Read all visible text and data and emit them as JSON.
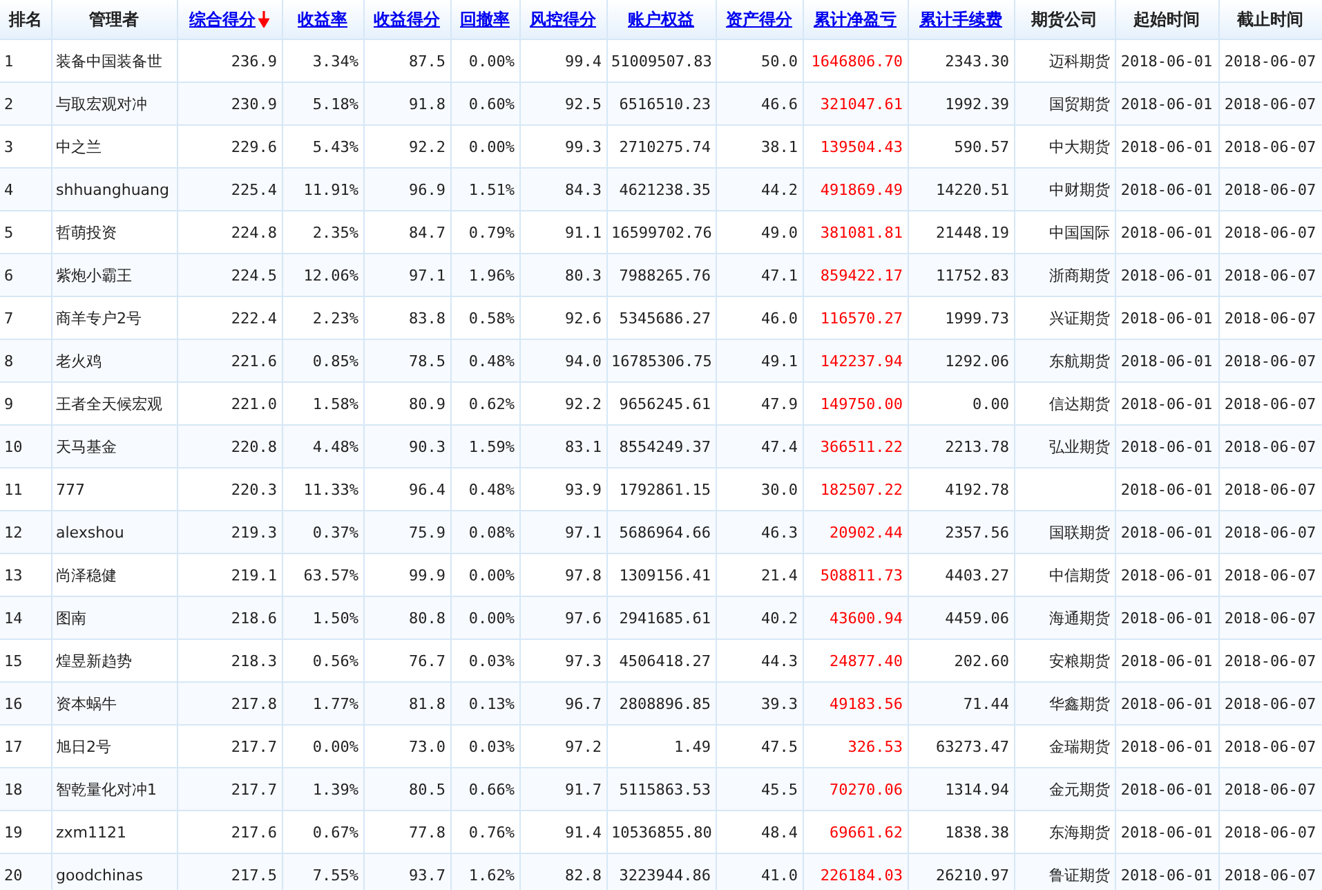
{
  "table": {
    "columns": [
      {
        "label": "排名",
        "kind": "plain",
        "sorted": false,
        "accent": false
      },
      {
        "label": "管理者",
        "kind": "plain",
        "sorted": false,
        "accent": false
      },
      {
        "label": "综合得分",
        "kind": "link",
        "sorted": true,
        "accent": false
      },
      {
        "label": "收益率",
        "kind": "link",
        "sorted": false,
        "accent": false
      },
      {
        "label": "收益得分",
        "kind": "link",
        "sorted": false,
        "accent": false
      },
      {
        "label": "回撤率",
        "kind": "link",
        "sorted": false,
        "accent": false
      },
      {
        "label": "风控得分",
        "kind": "link",
        "sorted": false,
        "accent": false
      },
      {
        "label": "账户权益",
        "kind": "link",
        "sorted": false,
        "accent": false
      },
      {
        "label": "资产得分",
        "kind": "link",
        "sorted": false,
        "accent": false
      },
      {
        "label": "累计净盈亏",
        "kind": "link",
        "sorted": false,
        "accent": true
      },
      {
        "label": "累计手续费",
        "kind": "link",
        "sorted": false,
        "accent": false
      },
      {
        "label": "期货公司",
        "kind": "plain",
        "sorted": false,
        "accent": false
      },
      {
        "label": "起始时间",
        "kind": "plain",
        "sorted": false,
        "accent": false
      },
      {
        "label": "截止时间",
        "kind": "plain",
        "sorted": false,
        "accent": false
      }
    ],
    "rows": [
      {
        "cells": [
          "1",
          "装备中国装备世",
          "236.9",
          "3.34%",
          "87.5",
          "0.00%",
          "99.4",
          "51009507.83",
          "50.0",
          "1646806.70",
          "2343.30",
          "迈科期货",
          "2018-06-01",
          "2018-06-07"
        ]
      },
      {
        "cells": [
          "2",
          "与取宏观对冲",
          "230.9",
          "5.18%",
          "91.8",
          "0.60%",
          "92.5",
          "6516510.23",
          "46.6",
          "321047.61",
          "1992.39",
          "国贸期货",
          "2018-06-01",
          "2018-06-07"
        ]
      },
      {
        "cells": [
          "3",
          "中之兰",
          "229.6",
          "5.43%",
          "92.2",
          "0.00%",
          "99.3",
          "2710275.74",
          "38.1",
          "139504.43",
          "590.57",
          "中大期货",
          "2018-06-01",
          "2018-06-07"
        ]
      },
      {
        "cells": [
          "4",
          "shhuanghuang",
          "225.4",
          "11.91%",
          "96.9",
          "1.51%",
          "84.3",
          "4621238.35",
          "44.2",
          "491869.49",
          "14220.51",
          "中财期货",
          "2018-06-01",
          "2018-06-07"
        ]
      },
      {
        "cells": [
          "5",
          "哲萌投资",
          "224.8",
          "2.35%",
          "84.7",
          "0.79%",
          "91.1",
          "16599702.76",
          "49.0",
          "381081.81",
          "21448.19",
          "中国国际",
          "2018-06-01",
          "2018-06-07"
        ]
      },
      {
        "cells": [
          "6",
          "紫炮小霸王",
          "224.5",
          "12.06%",
          "97.1",
          "1.96%",
          "80.3",
          "7988265.76",
          "47.1",
          "859422.17",
          "11752.83",
          "浙商期货",
          "2018-06-01",
          "2018-06-07"
        ]
      },
      {
        "cells": [
          "7",
          "商羊专户2号",
          "222.4",
          "2.23%",
          "83.8",
          "0.58%",
          "92.6",
          "5345686.27",
          "46.0",
          "116570.27",
          "1999.73",
          "兴证期货",
          "2018-06-01",
          "2018-06-07"
        ]
      },
      {
        "cells": [
          "8",
          "老火鸡",
          "221.6",
          "0.85%",
          "78.5",
          "0.48%",
          "94.0",
          "16785306.75",
          "49.1",
          "142237.94",
          "1292.06",
          "东航期货",
          "2018-06-01",
          "2018-06-07"
        ]
      },
      {
        "cells": [
          "9",
          "王者全天候宏观",
          "221.0",
          "1.58%",
          "80.9",
          "0.62%",
          "92.2",
          "9656245.61",
          "47.9",
          "149750.00",
          "0.00",
          "信达期货",
          "2018-06-01",
          "2018-06-07"
        ]
      },
      {
        "cells": [
          "10",
          "天马基金",
          "220.8",
          "4.48%",
          "90.3",
          "1.59%",
          "83.1",
          "8554249.37",
          "47.4",
          "366511.22",
          "2213.78",
          "弘业期货",
          "2018-06-01",
          "2018-06-07"
        ]
      },
      {
        "cells": [
          "11",
          "777",
          "220.3",
          "11.33%",
          "96.4",
          "0.48%",
          "93.9",
          "1792861.15",
          "30.0",
          "182507.22",
          "4192.78",
          null,
          "2018-06-01",
          "2018-06-07"
        ]
      },
      {
        "cells": [
          "12",
          "alexshou",
          "219.3",
          "0.37%",
          "75.9",
          "0.08%",
          "97.1",
          "5686964.66",
          "46.3",
          "20902.44",
          "2357.56",
          "国联期货",
          "2018-06-01",
          "2018-06-07"
        ]
      },
      {
        "cells": [
          "13",
          "尚泽稳健",
          "219.1",
          "63.57%",
          "99.9",
          "0.00%",
          "97.8",
          "1309156.41",
          "21.4",
          "508811.73",
          "4403.27",
          "中信期货",
          "2018-06-01",
          "2018-06-07"
        ]
      },
      {
        "cells": [
          "14",
          "图南",
          "218.6",
          "1.50%",
          "80.8",
          "0.00%",
          "97.6",
          "2941685.61",
          "40.2",
          "43600.94",
          "4459.06",
          "海通期货",
          "2018-06-01",
          "2018-06-07"
        ]
      },
      {
        "cells": [
          "15",
          "煌昱新趋势",
          "218.3",
          "0.56%",
          "76.7",
          "0.03%",
          "97.3",
          "4506418.27",
          "44.3",
          "24877.40",
          "202.60",
          "安粮期货",
          "2018-06-01",
          "2018-06-07"
        ]
      },
      {
        "cells": [
          "16",
          "资本蜗牛",
          "217.8",
          "1.77%",
          "81.8",
          "0.13%",
          "96.7",
          "2808896.85",
          "39.3",
          "49183.56",
          "71.44",
          "华鑫期货",
          "2018-06-01",
          "2018-06-07"
        ]
      },
      {
        "cells": [
          "17",
          "旭日2号",
          "217.7",
          "0.00%",
          "73.0",
          "0.03%",
          "97.2",
          "1.49",
          "47.5",
          "326.53",
          "63273.47",
          "金瑞期货",
          "2018-06-01",
          "2018-06-07"
        ]
      },
      {
        "cells": [
          "18",
          "智乾量化对冲1",
          "217.7",
          "1.39%",
          "80.5",
          "0.66%",
          "91.7",
          "5115863.53",
          "45.5",
          "70270.06",
          "1314.94",
          "金元期货",
          "2018-06-01",
          "2018-06-07"
        ]
      },
      {
        "cells": [
          "19",
          "zxm1121",
          "217.6",
          "0.67%",
          "77.8",
          "0.76%",
          "91.4",
          "10536855.80",
          "48.4",
          "69661.62",
          "1838.38",
          "东海期货",
          "2018-06-01",
          "2018-06-07"
        ]
      },
      {
        "cells": [
          "20",
          "goodchinas",
          "217.5",
          "7.55%",
          "93.7",
          "1.62%",
          "82.8",
          "3223944.86",
          "41.0",
          "226184.03",
          "26210.97",
          "鲁证期货",
          "2018-06-01",
          "2018-06-07"
        ]
      }
    ]
  }
}
